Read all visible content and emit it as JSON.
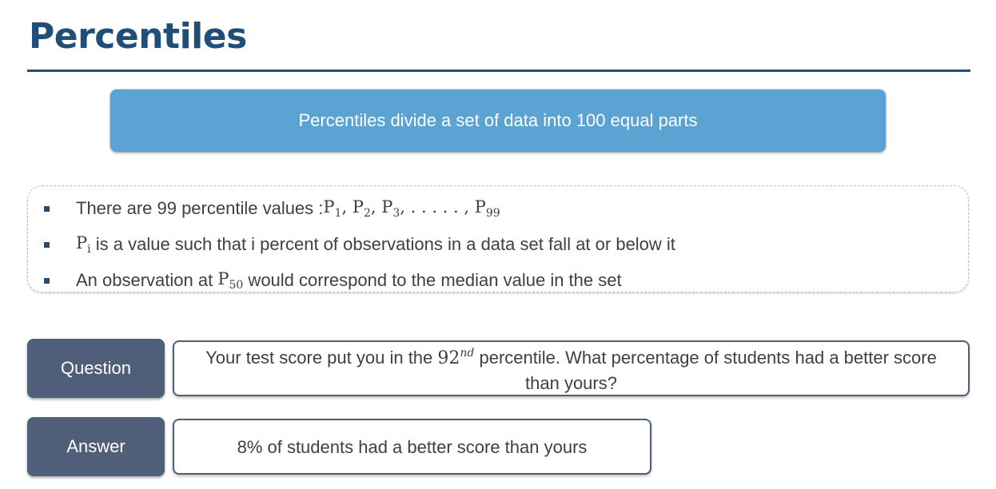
{
  "slide": {
    "title": "Percentiles",
    "banner": "Percentiles divide a set of data into 100 equal parts",
    "bullets": {
      "b1_text": "There are 99 percentile values : ",
      "b1_p": "P",
      "b1_sub1": "1",
      "b1_sep1": ", P",
      "b1_sub2": "2",
      "b1_sep2": ", P",
      "b1_sub3": "3",
      "b1_mid": ", . . . . . , P",
      "b1_sub4": "99",
      "b2_p": "P",
      "b2_sub": "i",
      "b2_text": " is a value such that i percent of observations in a data set fall at or below it",
      "b3_text": "An observation at ",
      "b3_p": "P",
      "b3_sub": "50",
      "b3_text2": " would correspond to the median value in the set"
    },
    "question": {
      "label": "Question",
      "text1": "Your test score put you in the ",
      "num": "92",
      "sup": "nd",
      "text2": " percentile. What percentage of students had a better score than yours?"
    },
    "answer": {
      "label": "Answer",
      "text": "8% of students had a better score than yours"
    }
  },
  "colors": {
    "title": "#1f4e79",
    "banner": "#5ba3d3",
    "label_box": "#4f5f79"
  }
}
